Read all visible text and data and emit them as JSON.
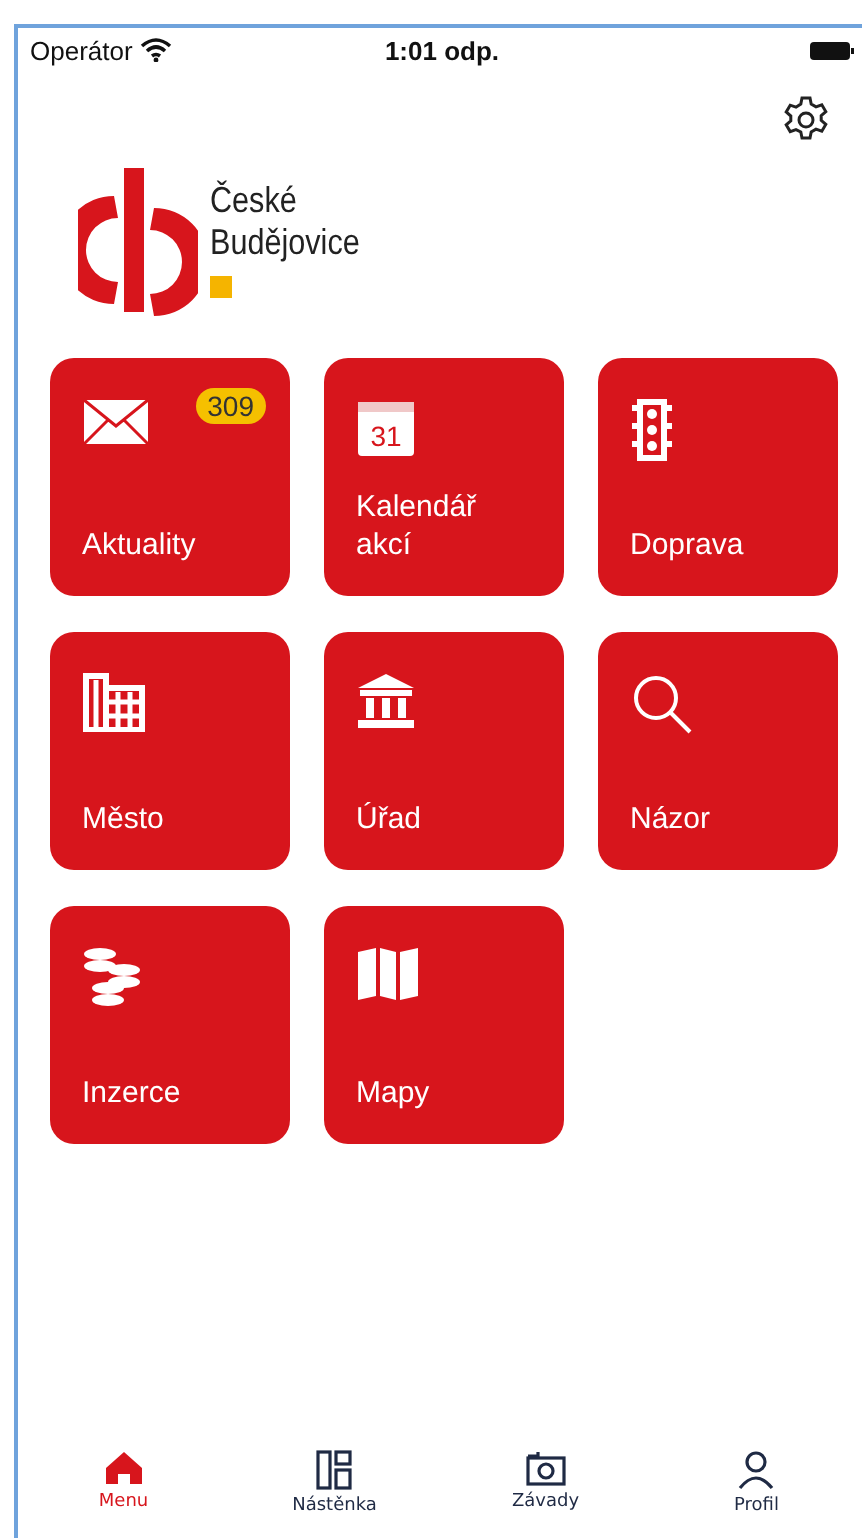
{
  "status_bar": {
    "carrier": "Operátor",
    "time": "1:01 odp."
  },
  "logo": {
    "lines": [
      "České",
      "Budějovice"
    ]
  },
  "tiles": [
    {
      "label": "Aktuality",
      "badge": "309"
    },
    {
      "label": "Kalendář akcí",
      "icon_text": "31"
    },
    {
      "label": "Doprava"
    },
    {
      "label": "Město"
    },
    {
      "label": "Úřad"
    },
    {
      "label": "Názor"
    },
    {
      "label": "Inzerce"
    },
    {
      "label": "Mapy"
    }
  ],
  "tab_bar": [
    {
      "label": "Menu",
      "selected": true
    },
    {
      "label": "Nástěnka",
      "selected": false
    },
    {
      "label": "Závady",
      "selected": false
    },
    {
      "label": "Profil",
      "selected": false
    }
  ]
}
